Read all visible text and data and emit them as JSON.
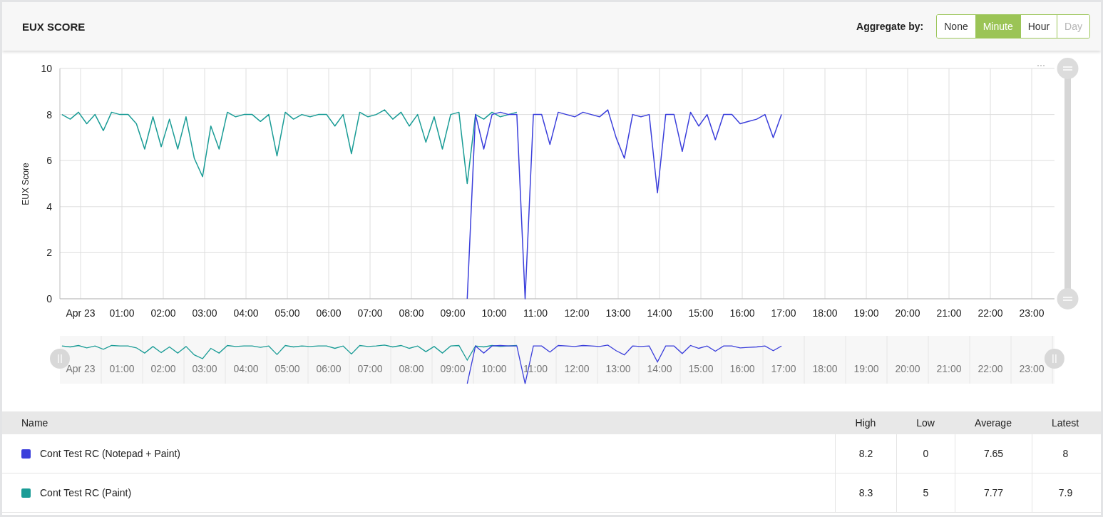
{
  "header": {
    "title": "EUX SCORE",
    "aggregate_label": "Aggregate by:",
    "aggregate_options": [
      {
        "label": "None",
        "selected": false,
        "disabled": false
      },
      {
        "label": "Minute",
        "selected": true,
        "disabled": false
      },
      {
        "label": "Hour",
        "selected": false,
        "disabled": false
      },
      {
        "label": "Day",
        "selected": false,
        "disabled": true
      }
    ]
  },
  "chart": {
    "chart_data": {
      "type": "line",
      "grid": true,
      "ylabel": "EUX Score",
      "ylim": [
        0,
        10
      ],
      "yticks": [
        0,
        2,
        4,
        6,
        8,
        10
      ],
      "xlim": [
        -0.5,
        23.55
      ],
      "xticks": [
        {
          "value": 0,
          "label": "Apr 23"
        },
        {
          "value": 1,
          "label": "01:00"
        },
        {
          "value": 2,
          "label": "02:00"
        },
        {
          "value": 3,
          "label": "03:00"
        },
        {
          "value": 4,
          "label": "04:00"
        },
        {
          "value": 5,
          "label": "05:00"
        },
        {
          "value": 6,
          "label": "06:00"
        },
        {
          "value": 7,
          "label": "07:00"
        },
        {
          "value": 8,
          "label": "08:00"
        },
        {
          "value": 9,
          "label": "09:00"
        },
        {
          "value": 10,
          "label": "10:00"
        },
        {
          "value": 11,
          "label": "11:00"
        },
        {
          "value": 12,
          "label": "12:00"
        },
        {
          "value": 13,
          "label": "13:00"
        },
        {
          "value": 14,
          "label": "14:00"
        },
        {
          "value": 15,
          "label": "15:00"
        },
        {
          "value": 16,
          "label": "16:00"
        },
        {
          "value": 17,
          "label": "17:00"
        },
        {
          "value": 18,
          "label": "18:00"
        },
        {
          "value": 19,
          "label": "19:00"
        },
        {
          "value": 20,
          "label": "20:00"
        },
        {
          "value": 21,
          "label": "21:00"
        },
        {
          "value": 22,
          "label": "22:00"
        },
        {
          "value": 23,
          "label": "23:00"
        }
      ],
      "x": [
        -0.45,
        -0.25,
        -0.05,
        0.15,
        0.35,
        0.55,
        0.75,
        0.95,
        1.15,
        1.35,
        1.55,
        1.75,
        1.95,
        2.15,
        2.35,
        2.55,
        2.75,
        2.95,
        3.15,
        3.35,
        3.55,
        3.75,
        3.95,
        4.15,
        4.35,
        4.55,
        4.75,
        4.95,
        5.15,
        5.35,
        5.55,
        5.75,
        5.95,
        6.15,
        6.35,
        6.55,
        6.75,
        6.95,
        7.15,
        7.35,
        7.55,
        7.75,
        7.95,
        8.15,
        8.35,
        8.55,
        8.75,
        8.95,
        9.15,
        9.35,
        9.55,
        9.75,
        9.95,
        10.15,
        10.35,
        10.55,
        10.75,
        10.95,
        11.15,
        11.35,
        11.55,
        11.75,
        11.95,
        12.15,
        12.35,
        12.55,
        12.75,
        12.95,
        13.15,
        13.35,
        13.55,
        13.75,
        13.95,
        14.15,
        14.35,
        14.55,
        14.75,
        14.95,
        15.15,
        15.35,
        15.55,
        15.75,
        15.95,
        16.15,
        16.35,
        16.55,
        16.75,
        16.95
      ],
      "series": [
        {
          "name": "Cont Test RC (Notepad + Paint)",
          "color": "#3b3fdb",
          "values": [
            null,
            null,
            null,
            null,
            null,
            null,
            null,
            null,
            null,
            null,
            null,
            null,
            null,
            null,
            null,
            null,
            null,
            null,
            null,
            null,
            null,
            null,
            null,
            null,
            null,
            null,
            null,
            null,
            null,
            null,
            null,
            null,
            null,
            null,
            null,
            null,
            null,
            null,
            null,
            null,
            null,
            null,
            null,
            null,
            null,
            null,
            null,
            null,
            null,
            0,
            8,
            6.5,
            8,
            8.1,
            8,
            8,
            0,
            8,
            8,
            6.7,
            8.1,
            8,
            7.9,
            8.1,
            8,
            7.9,
            8.2,
            7,
            6.1,
            8,
            7.9,
            8,
            4.6,
            8,
            8,
            6.4,
            8.1,
            7.5,
            8,
            6.9,
            8,
            8,
            7.6,
            7.7,
            7.8,
            8,
            7,
            8
          ]
        },
        {
          "name": "Cont Test RC (Paint)",
          "color": "#1a9c96",
          "values": [
            8,
            7.8,
            8.1,
            7.6,
            8,
            7.3,
            8.1,
            8,
            8,
            7.6,
            6.5,
            7.9,
            6.6,
            7.8,
            6.5,
            7.9,
            6.1,
            5.3,
            7.5,
            6.5,
            8.1,
            7.9,
            8,
            8,
            7.7,
            8,
            6.2,
            8.1,
            7.8,
            8,
            7.9,
            8,
            8,
            7.5,
            8,
            6.3,
            8.1,
            7.9,
            8,
            8.2,
            7.8,
            8.1,
            7.5,
            8,
            6.8,
            7.9,
            6.5,
            8,
            8.1,
            5,
            8,
            7.8,
            8.1,
            7.9,
            8,
            8.1,
            null,
            null,
            null,
            null,
            null,
            null,
            null,
            null,
            null,
            null,
            null,
            null,
            null,
            null,
            null,
            null,
            null,
            null,
            null,
            null,
            null,
            null,
            null,
            null,
            null,
            null,
            null,
            null,
            null,
            null,
            null,
            null
          ]
        }
      ]
    }
  },
  "navigator": {
    "labels": [
      "Apr 23",
      "01:00",
      "02:00",
      "03:00",
      "04:00",
      "05:00",
      "06:00",
      "07:00",
      "08:00",
      "09:00",
      "10:00",
      "11:00",
      "12:00",
      "13:00",
      "14:00",
      "15:00",
      "16:00",
      "17:00",
      "18:00",
      "19:00",
      "20:00",
      "21:00",
      "22:00",
      "23:00"
    ]
  },
  "table": {
    "columns": [
      "Name",
      "High",
      "Low",
      "Average",
      "Latest"
    ],
    "rows": [
      {
        "high": "8.2",
        "low": "0",
        "average": "7.65",
        "latest": "8"
      },
      {
        "high": "8.3",
        "low": "5",
        "average": "7.77",
        "latest": "7.9"
      }
    ]
  }
}
